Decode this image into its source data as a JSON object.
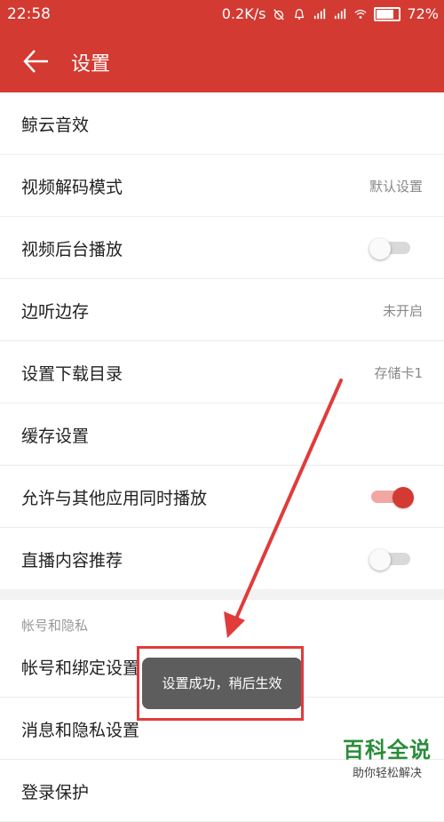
{
  "status_bar": {
    "time": "22:58",
    "speed": "0.2K/s",
    "battery": "72%",
    "icons": [
      "alarm-off-icon",
      "bell-icon",
      "signal-icon",
      "signal-icon",
      "wifi-icon",
      "battery-icon"
    ]
  },
  "app_bar": {
    "title": "设置",
    "back_icon": "arrow-left-icon"
  },
  "settings": [
    {
      "label": "鲸云音效"
    },
    {
      "label": "视频解码模式",
      "value": "默认设置"
    },
    {
      "label": "视频后台播放",
      "toggle": "off"
    },
    {
      "label": "边听边存",
      "value": "未开启"
    },
    {
      "label": "设置下载目录",
      "value": "存储卡1"
    },
    {
      "label": "缓存设置"
    },
    {
      "label": "允许与其他应用同时播放",
      "toggle": "on"
    },
    {
      "label": "直播内容推荐",
      "toggle": "off"
    }
  ],
  "section": {
    "title": "帐号和隐私"
  },
  "privacy_items": [
    {
      "label": "帐号和绑定设置"
    },
    {
      "label": "消息和隐私设置"
    },
    {
      "label": "登录保护"
    }
  ],
  "toast": {
    "text": "设置成功，稍后生效"
  },
  "watermark": {
    "title": "百科全说",
    "subtitle": "助你轻松解决"
  },
  "colors": {
    "accent": "#d33a31",
    "annotation": "#e13b3b"
  }
}
